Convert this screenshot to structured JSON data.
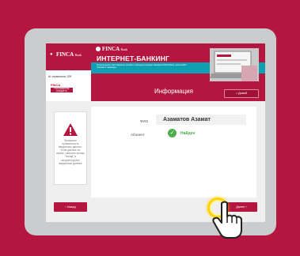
{
  "header": {
    "logo_left": "FINCA",
    "logo_left_small": "Bank",
    "terminal_label": "№ терминала: 209",
    "tab_logo": "FINCA",
    "tab_label_line1": "ПОГАШЕНИЕ",
    "tab_label_line2": "КРЕДИТА",
    "banner_logo": "FINCA",
    "banner_logo_small": "Bank",
    "banner_title": "ИНТЕРНЕТ-БАНКИНГ",
    "banner_text": "Контролируйте свои финансы онлайн с помощью интернет-банкинга FINCA Bank, выполняйте платежи и переводы."
  },
  "infobar": {
    "title": "Информация",
    "home_label": "Домой"
  },
  "side": {
    "warning_text": "Проверьте правильность введенных данных. Если данные не верны, нажмите кнопку \"Назад\" и скорректируйте введенные данные"
  },
  "main": {
    "fio_label": "ФИО",
    "fio_value": "Азаматов Азамат",
    "subscriber_label": "Абонент",
    "found_icon": "check-icon",
    "found_text": "Найден"
  },
  "footer": {
    "back_label": "‹ Назад",
    "next_label": "Далее ›"
  },
  "colors": {
    "brand": "#b5163f",
    "accent_teal": "#0e9fb3",
    "success": "#4cae4c"
  }
}
